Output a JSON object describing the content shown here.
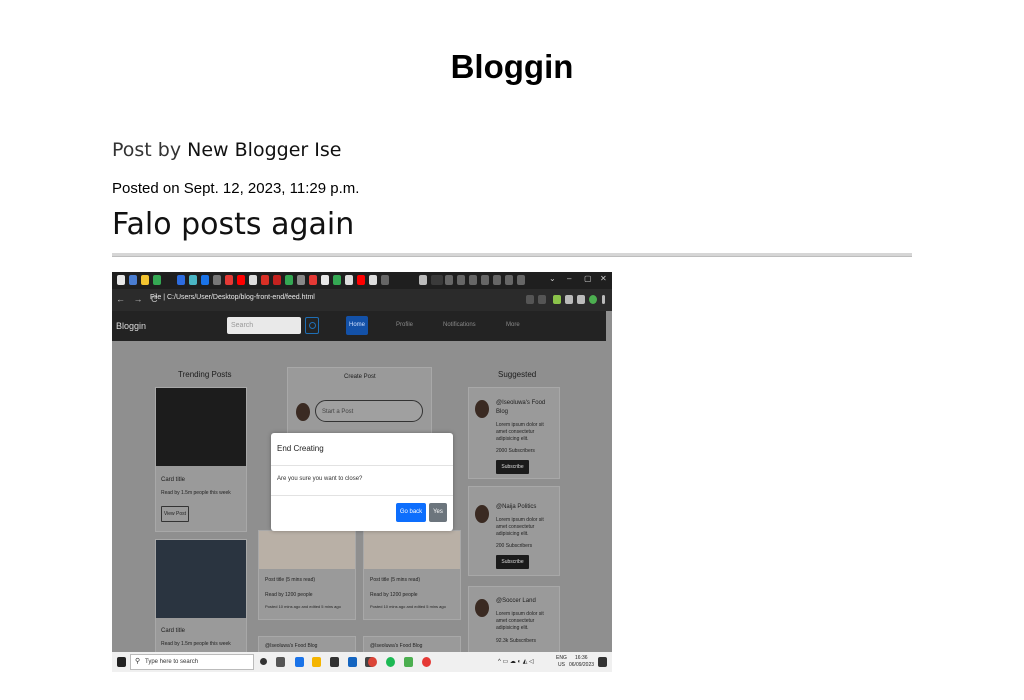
{
  "site": {
    "title": "Bloggin"
  },
  "post": {
    "author_prefix": "Post by",
    "author_name": "New Blogger Ise",
    "posted_on": "Posted on Sept. 12, 2023, 11:29 p.m.",
    "heading": "Falo posts again"
  },
  "screenshot": {
    "browser": {
      "url": "C:/Users/User/Desktop/blog-front-end/feed.html",
      "nav_icons": "← → C",
      "file_label": "File",
      "window_controls": [
        "⌄",
        "–",
        "▢",
        "✕"
      ]
    },
    "app": {
      "brand": "Bloggin",
      "search_placeholder": "Search",
      "nav": [
        "Home",
        "Profile",
        "Notifications",
        "More"
      ]
    },
    "trending": {
      "heading": "Trending Posts",
      "cards": [
        {
          "title": "Card title",
          "meta": "Read by 1.5m people this week",
          "button": "View Post"
        },
        {
          "title": "Card title",
          "meta": "Read by 1.5m people this week"
        }
      ]
    },
    "feed": {
      "create_heading": "Create Post",
      "start_placeholder": "Start a Post",
      "posts": [
        {
          "title": "Post title (5 mins read)",
          "readers": "Read by 1200 people",
          "posted": "Posted 10 mins ago and edited 5 mins ago"
        },
        {
          "title": "Post title (5 mins read)",
          "readers": "Read by 1200 people",
          "posted": "Posted 10 mins ago and edited 5 mins ago"
        }
      ],
      "footer_blogs": [
        "@Iseoluwa's Food Blog",
        "@Iseoluwa's Food Blog"
      ]
    },
    "suggested": {
      "heading": "Suggested",
      "items": [
        {
          "name": "@Iseoluwa's Food Blog",
          "desc": "Lorem ipsum dolor sit amet consectetur adipisicing elit.",
          "subs": "2000 Subscribers",
          "button": "Subscribe"
        },
        {
          "name": "@Naija Politics",
          "desc": "Lorem ipsum dolor sit amet consectetur adipisicing elit.",
          "subs": "200 Subscribers",
          "button": "Subscribe"
        },
        {
          "name": "@Soccer Land",
          "desc": "Lorem ipsum dolor sit amet consectetur adipisicing elit.",
          "subs": "92.3k Subscribers"
        }
      ]
    },
    "modal": {
      "title": "End Creating",
      "body": "Are you sure you want to close?",
      "primary": "Go back",
      "secondary": "Yes"
    },
    "taskbar": {
      "search_placeholder": "Type here to search",
      "lang_top": "ENG",
      "lang_bottom": "US",
      "time": "16:36",
      "date": "06/09/2023"
    }
  }
}
